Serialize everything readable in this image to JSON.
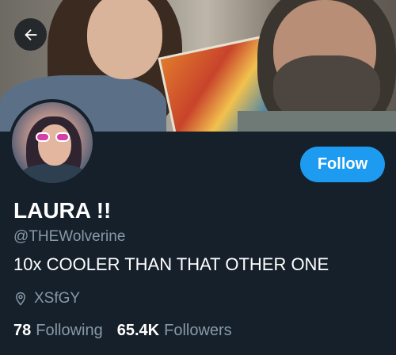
{
  "profile": {
    "display_name": "LAURA !!",
    "handle": "@THEWolverine",
    "bio": "10x COOLER THAN THAT OTHER ONE",
    "location": "XSfGY",
    "follow_label": "Follow"
  },
  "stats": {
    "following_count": "78",
    "following_label": "Following",
    "followers_count": "65.4K",
    "followers_label": "Followers"
  },
  "icons": {
    "back": "arrow-left-icon",
    "location": "location-pin-icon"
  },
  "colors": {
    "background": "#15202b",
    "accent": "#1d9bf0",
    "secondary_text": "#8899a6",
    "primary_text": "#ffffff"
  }
}
